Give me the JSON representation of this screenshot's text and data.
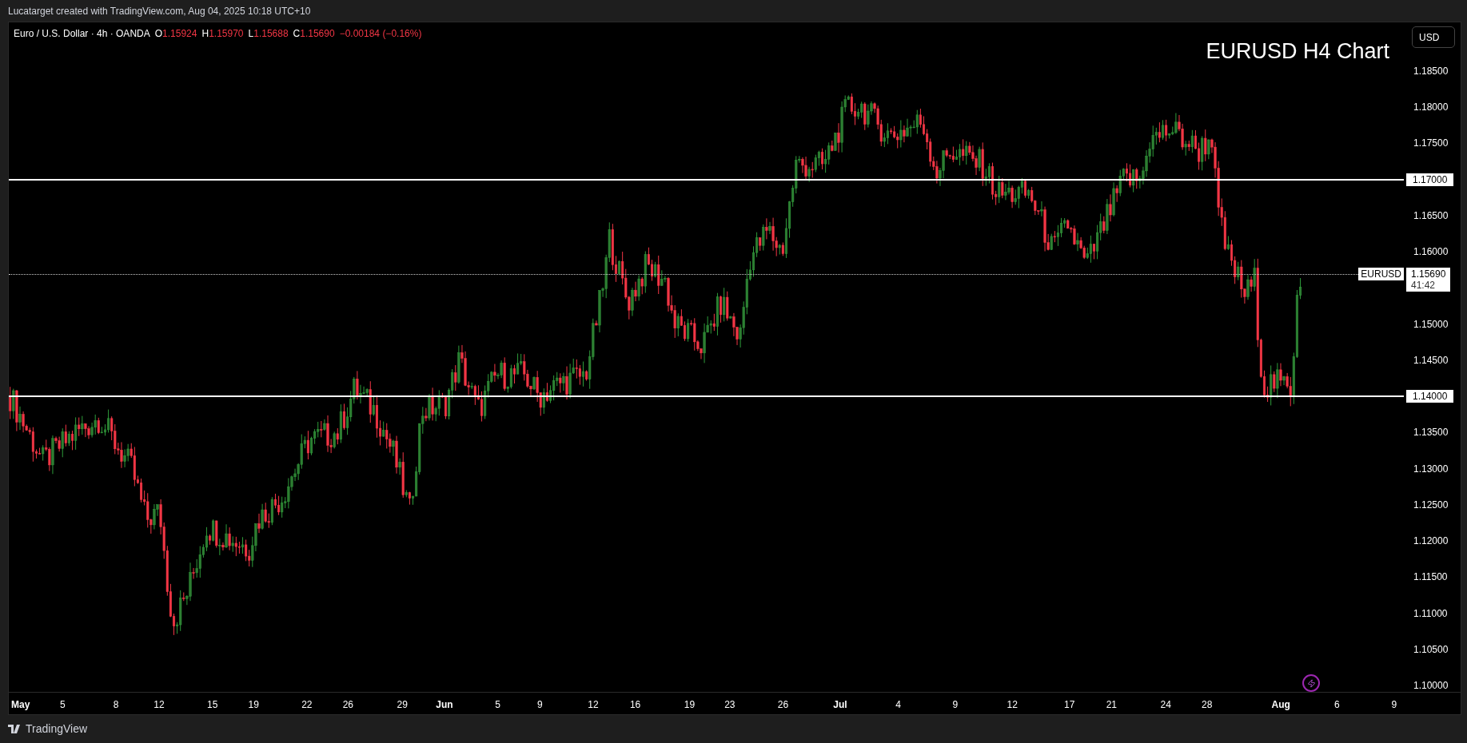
{
  "header": {
    "attribution": "Lucatarget created with TradingView.com, Aug 04, 2025 10:18 UTC+10"
  },
  "legend": {
    "symbol": "Euro / U.S. Dollar · 4h · OANDA",
    "values": [
      {
        "key": "O",
        "value": "1.15924"
      },
      {
        "key": "H",
        "value": "1.15970"
      },
      {
        "key": "L",
        "value": "1.15688"
      },
      {
        "key": "C",
        "value": "1.15690"
      }
    ],
    "change": "−0.00184 (−0.16%)"
  },
  "chart_title": "EURUSD H4 Chart",
  "currency_button": "USD",
  "price_axis": [
    {
      "label": "1.18500",
      "kind": "tick"
    },
    {
      "label": "1.18000",
      "kind": "tick"
    },
    {
      "label": "1.17500",
      "kind": "tick"
    },
    {
      "label": "1.17000",
      "kind": "level"
    },
    {
      "label": "1.16500",
      "kind": "tick"
    },
    {
      "label": "1.16000",
      "kind": "tick"
    },
    {
      "label": "1.15000",
      "kind": "tick"
    },
    {
      "label": "1.14500",
      "kind": "tick"
    },
    {
      "label": "1.14000",
      "kind": "level"
    },
    {
      "label": "1.13500",
      "kind": "tick"
    },
    {
      "label": "1.13000",
      "kind": "tick"
    },
    {
      "label": "1.12500",
      "kind": "tick"
    },
    {
      "label": "1.12000",
      "kind": "tick"
    },
    {
      "label": "1.11500",
      "kind": "tick"
    },
    {
      "label": "1.11000",
      "kind": "tick"
    },
    {
      "label": "1.10500",
      "kind": "tick"
    },
    {
      "label": "1.10000",
      "kind": "tick"
    }
  ],
  "last_price": {
    "symbol": "EURUSD",
    "price": "1.15690",
    "countdown": "41:42"
  },
  "time_axis": [
    {
      "label": "May",
      "kind": "month"
    },
    {
      "label": "5",
      "kind": "day"
    },
    {
      "label": "8",
      "kind": "day"
    },
    {
      "label": "12",
      "kind": "day"
    },
    {
      "label": "15",
      "kind": "day"
    },
    {
      "label": "19",
      "kind": "day"
    },
    {
      "label": "22",
      "kind": "day"
    },
    {
      "label": "26",
      "kind": "day"
    },
    {
      "label": "29",
      "kind": "day"
    },
    {
      "label": "Jun",
      "kind": "month"
    },
    {
      "label": "5",
      "kind": "day"
    },
    {
      "label": "9",
      "kind": "day"
    },
    {
      "label": "12",
      "kind": "day"
    },
    {
      "label": "16",
      "kind": "day"
    },
    {
      "label": "19",
      "kind": "day"
    },
    {
      "label": "23",
      "kind": "day"
    },
    {
      "label": "26",
      "kind": "day"
    },
    {
      "label": "Jul",
      "kind": "month"
    },
    {
      "label": "4",
      "kind": "day"
    },
    {
      "label": "9",
      "kind": "day"
    },
    {
      "label": "12",
      "kind": "day"
    },
    {
      "label": "17",
      "kind": "day"
    },
    {
      "label": "21",
      "kind": "day"
    },
    {
      "label": "24",
      "kind": "day"
    },
    {
      "label": "28",
      "kind": "day"
    },
    {
      "label": "Aug",
      "kind": "month"
    },
    {
      "label": "6",
      "kind": "day"
    },
    {
      "label": "9",
      "kind": "day"
    }
  ],
  "footer": {
    "brand": "TradingView"
  }
}
